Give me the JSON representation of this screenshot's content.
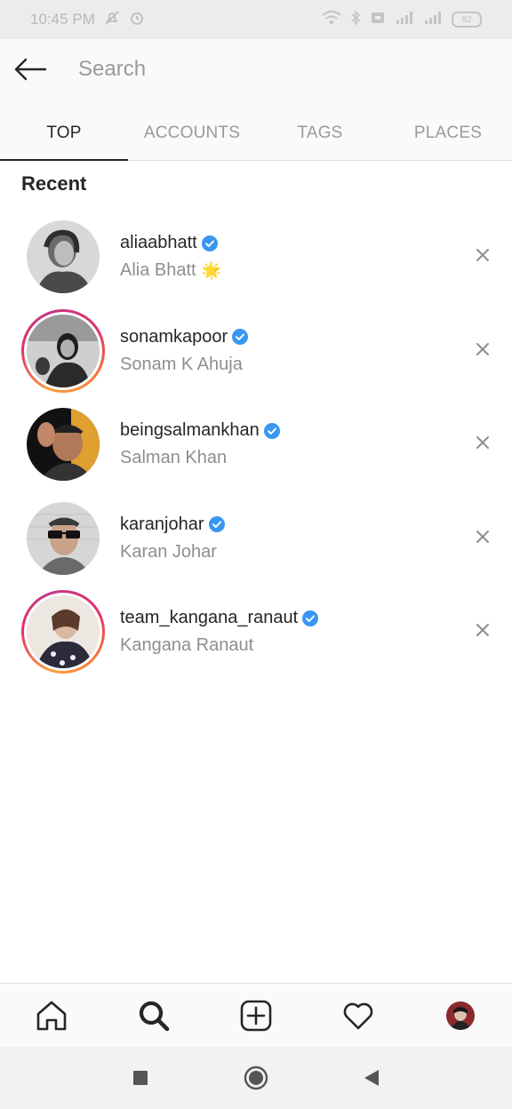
{
  "status_bar": {
    "time": "10:45 PM",
    "battery": "82",
    "icons": [
      "mute-icon",
      "alarm-icon",
      "wifi-icon",
      "bluetooth-icon",
      "sim-icon",
      "signal-icon",
      "signal-icon",
      "battery-icon"
    ]
  },
  "search": {
    "placeholder": "Search",
    "value": ""
  },
  "tabs": [
    {
      "label": "TOP",
      "active": true
    },
    {
      "label": "ACCOUNTS",
      "active": false
    },
    {
      "label": "TAGS",
      "active": false
    },
    {
      "label": "PLACES",
      "active": false
    }
  ],
  "recent": {
    "title": "Recent",
    "items": [
      {
        "username": "aliaabhatt",
        "fullname": "Alia Bhatt",
        "emoji": "🌟",
        "verified": true,
        "story_ring": false
      },
      {
        "username": "sonamkapoor",
        "fullname": "Sonam K Ahuja",
        "emoji": "",
        "verified": true,
        "story_ring": true
      },
      {
        "username": "beingsalmankhan",
        "fullname": "Salman Khan",
        "emoji": "",
        "verified": true,
        "story_ring": false
      },
      {
        "username": "karanjohar",
        "fullname": "Karan Johar",
        "emoji": "",
        "verified": true,
        "story_ring": false
      },
      {
        "username": "team_kangana_ranaut",
        "fullname": "Kangana Ranaut",
        "emoji": "",
        "verified": true,
        "story_ring": true
      }
    ]
  },
  "bottom_nav": [
    "home-icon",
    "search-icon",
    "add-post-icon",
    "heart-icon",
    "profile-avatar"
  ],
  "system_nav": [
    "recents-button",
    "home-button",
    "back-button"
  ],
  "colors": {
    "verified_blue": "#3897f0",
    "text_primary": "#262626",
    "text_secondary": "#8e8e8e",
    "story_ring": "#e1306c"
  }
}
